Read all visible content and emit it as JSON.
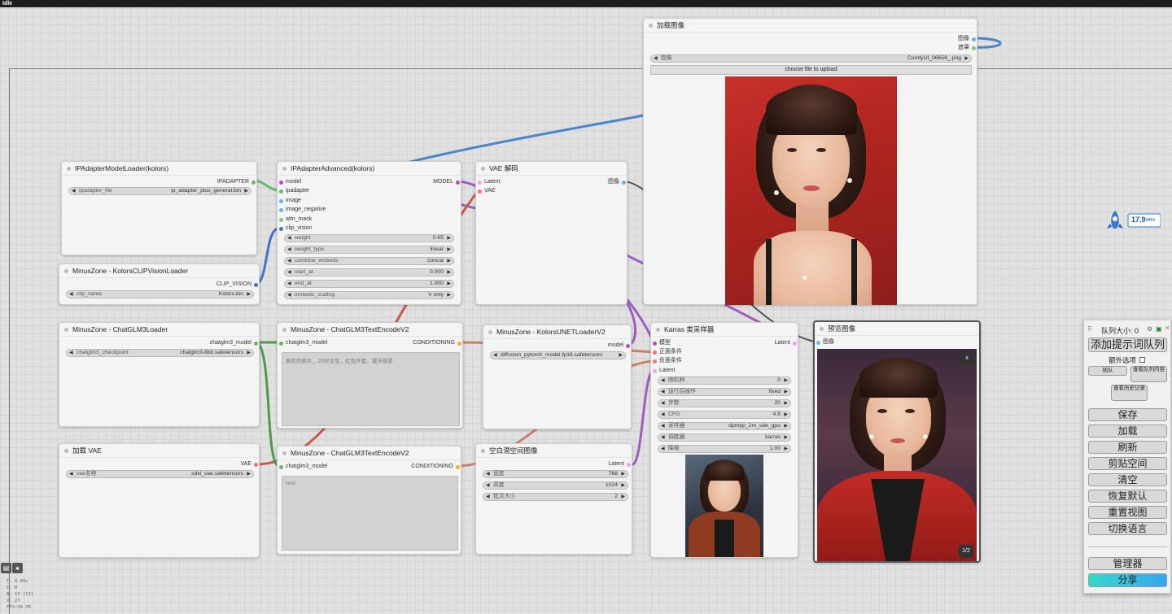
{
  "topbar": {
    "status": "Idle"
  },
  "colors": {
    "model": "#b54dc7",
    "clip": "#3a8cff",
    "image": "#64b5f6",
    "latent": "#ff9cf9",
    "conditioning": "#ffa931",
    "vae": "#ff6e6e",
    "mask": "#81c784",
    "chatglm": "#6fb364"
  },
  "nodes": {
    "ipadapter_loader": {
      "title": "IPAdapterModelLoader(kolors)",
      "output": "IPADAPTER",
      "widget": {
        "name": "ipadapter_file",
        "value": "ip_adapter_plus_general.bin"
      }
    },
    "clip_vision_loader": {
      "title": "MinusZone - KolorsCLIPVisionLoader",
      "output": "CLIP_VISION",
      "widget": {
        "name": "clip_name",
        "value": "Kolors.bin"
      }
    },
    "ipadapter_advanced": {
      "title": "IPAdapterAdvanced(kolors)",
      "inputs": [
        "model",
        "ipadapter",
        "image",
        "image_negative",
        "attn_mask",
        "clip_vision"
      ],
      "output": "MODEL",
      "widgets": [
        {
          "name": "weight",
          "value": "0.65"
        },
        {
          "name": "weight_type",
          "value": "linear"
        },
        {
          "name": "combine_embeds",
          "value": "concat"
        },
        {
          "name": "start_at",
          "value": "0.000"
        },
        {
          "name": "end_at",
          "value": "1.000"
        },
        {
          "name": "embeds_scaling",
          "value": "V only"
        }
      ]
    },
    "vae_decode": {
      "title": "VAE 解码",
      "inputs": [
        "Latent",
        "VAE"
      ],
      "output": "图像"
    },
    "load_image": {
      "title": "加载图像",
      "outputs": [
        "图像",
        "遮罩"
      ],
      "widget": {
        "name": "图像",
        "value": "ComfyUI_06656_.png"
      },
      "upload_label": "choose file to upload"
    },
    "chatglm_loader": {
      "title": "MinusZone - ChatGLM3Loader",
      "output": "chatglm3_model",
      "widget": {
        "name": "chatglm3_checkpoint",
        "value": "chatglm3-8bit.safetensors"
      }
    },
    "text_encode_pos": {
      "title": "MinusZone - ChatGLM3TextEncodeV2",
      "input": "chatglm3_model",
      "output": "CONDITIONING",
      "text": "真实的照片，20岁女生，红色外套，城市夜景"
    },
    "unet_loader": {
      "title": "MinusZone - KolorsUNETLoaderV2",
      "output": "model",
      "widget": {
        "name": "unet_name",
        "value": "diffusion_pytorch_model.fp16.safetensors"
      }
    },
    "ksampler": {
      "title": "Karras 类采样器",
      "inputs": [
        "模型",
        "正面条件",
        "负面条件",
        "Latent"
      ],
      "output": "Latent",
      "widgets": [
        {
          "name": "随机种",
          "value": "0"
        },
        {
          "name": "运行后操作",
          "value": "fixed"
        },
        {
          "name": "步数",
          "value": "20"
        },
        {
          "name": "CFG",
          "value": "4.5"
        },
        {
          "name": "采样器",
          "value": "dpmpp_2m_sde_gpu"
        },
        {
          "name": "调度器",
          "value": "karras"
        },
        {
          "name": "降噪",
          "value": "1.00"
        }
      ]
    },
    "preview_image": {
      "title": "预览图像",
      "input": "图像",
      "close": "x",
      "counter": "1/2"
    },
    "vae_loader": {
      "title": "加载 VAE",
      "output": "VAE",
      "widget": {
        "name": "vae名称",
        "value": "sdxl_vae.safetensors"
      }
    },
    "text_encode_neg": {
      "title": "MinusZone - ChatGLM3TextEncodeV2",
      "input": "chatglm3_model",
      "output": "CONDITIONING",
      "text": "test"
    },
    "empty_latent": {
      "title": "空白潜空间图像",
      "output": "Latent",
      "widgets": [
        {
          "name": "宽度",
          "value": "768"
        },
        {
          "name": "高度",
          "value": "1024"
        },
        {
          "name": "批次大小",
          "value": "2"
        }
      ]
    }
  },
  "monitor": {
    "value": "17.9",
    "unit": "MB/s"
  },
  "panel": {
    "queue_size": "队列大小: 0",
    "queue_prompt": "添加提示词队列",
    "extra_options": "额外选项",
    "insert": "插队",
    "view_queue": "查看队列内容",
    "view_history": "查看历史记录",
    "save": "保存",
    "load": "加载",
    "refresh": "刷新",
    "clipspace": "剪贴空间",
    "clear": "清空",
    "reset": "恢复默认",
    "reset_view": "重置视图",
    "switch_lang": "切换语言",
    "manager": "管理器",
    "share": "分享"
  },
  "stats": {
    "l1": "T: 0.00s",
    "l2": "I: 0",
    "l3": "N: 13 [13]",
    "l4": "V: 27",
    "l5": "FPS:30.30"
  }
}
